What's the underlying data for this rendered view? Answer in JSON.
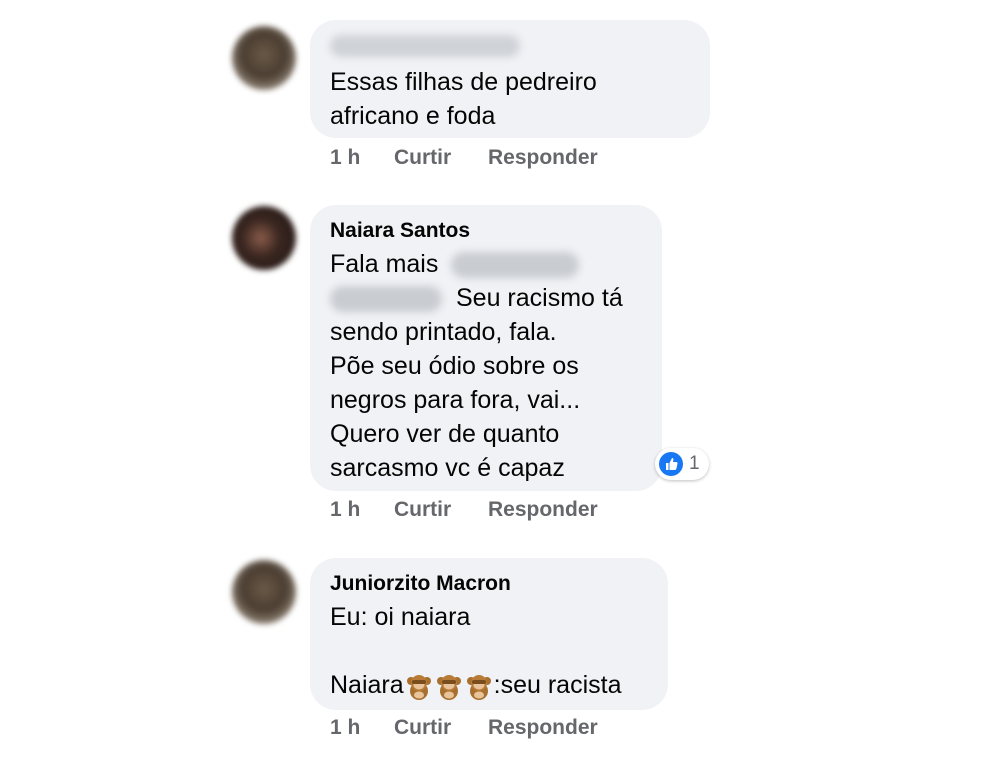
{
  "comments": [
    {
      "author_blurred": true,
      "lines": [
        "Essas filhas de pedreiro",
        "africano e foda"
      ],
      "time": "1 h",
      "like_label": "Curtir",
      "reply_label": "Responder"
    },
    {
      "author": "Naiara Santos",
      "line1_prefix": "Fala mais",
      "line2_suffix": "Seu racismo tá",
      "lines_rest": [
        "sendo printado, fala.",
        "Põe seu ódio sobre os",
        "negros para fora, vai...",
        "Quero ver de quanto",
        "sarcasmo vc é capaz"
      ],
      "reaction_icon": "like-icon",
      "reaction_count": "1",
      "time": "1 h",
      "like_label": "Curtir",
      "reply_label": "Responder"
    },
    {
      "author": "Juniorzito Macron",
      "line1": "Eu: oi naiara",
      "line3_prefix": "Naiara",
      "emoji_icon": "monkey-emoji-icon",
      "emoji_count": 3,
      "line3_suffix": ":seu racista",
      "time": "1 h",
      "like_label": "Curtir",
      "reply_label": "Responder"
    }
  ],
  "colors": {
    "bubble": "#f0f2f5",
    "meta_text": "#65676b",
    "like_blue": "#1877f2"
  }
}
